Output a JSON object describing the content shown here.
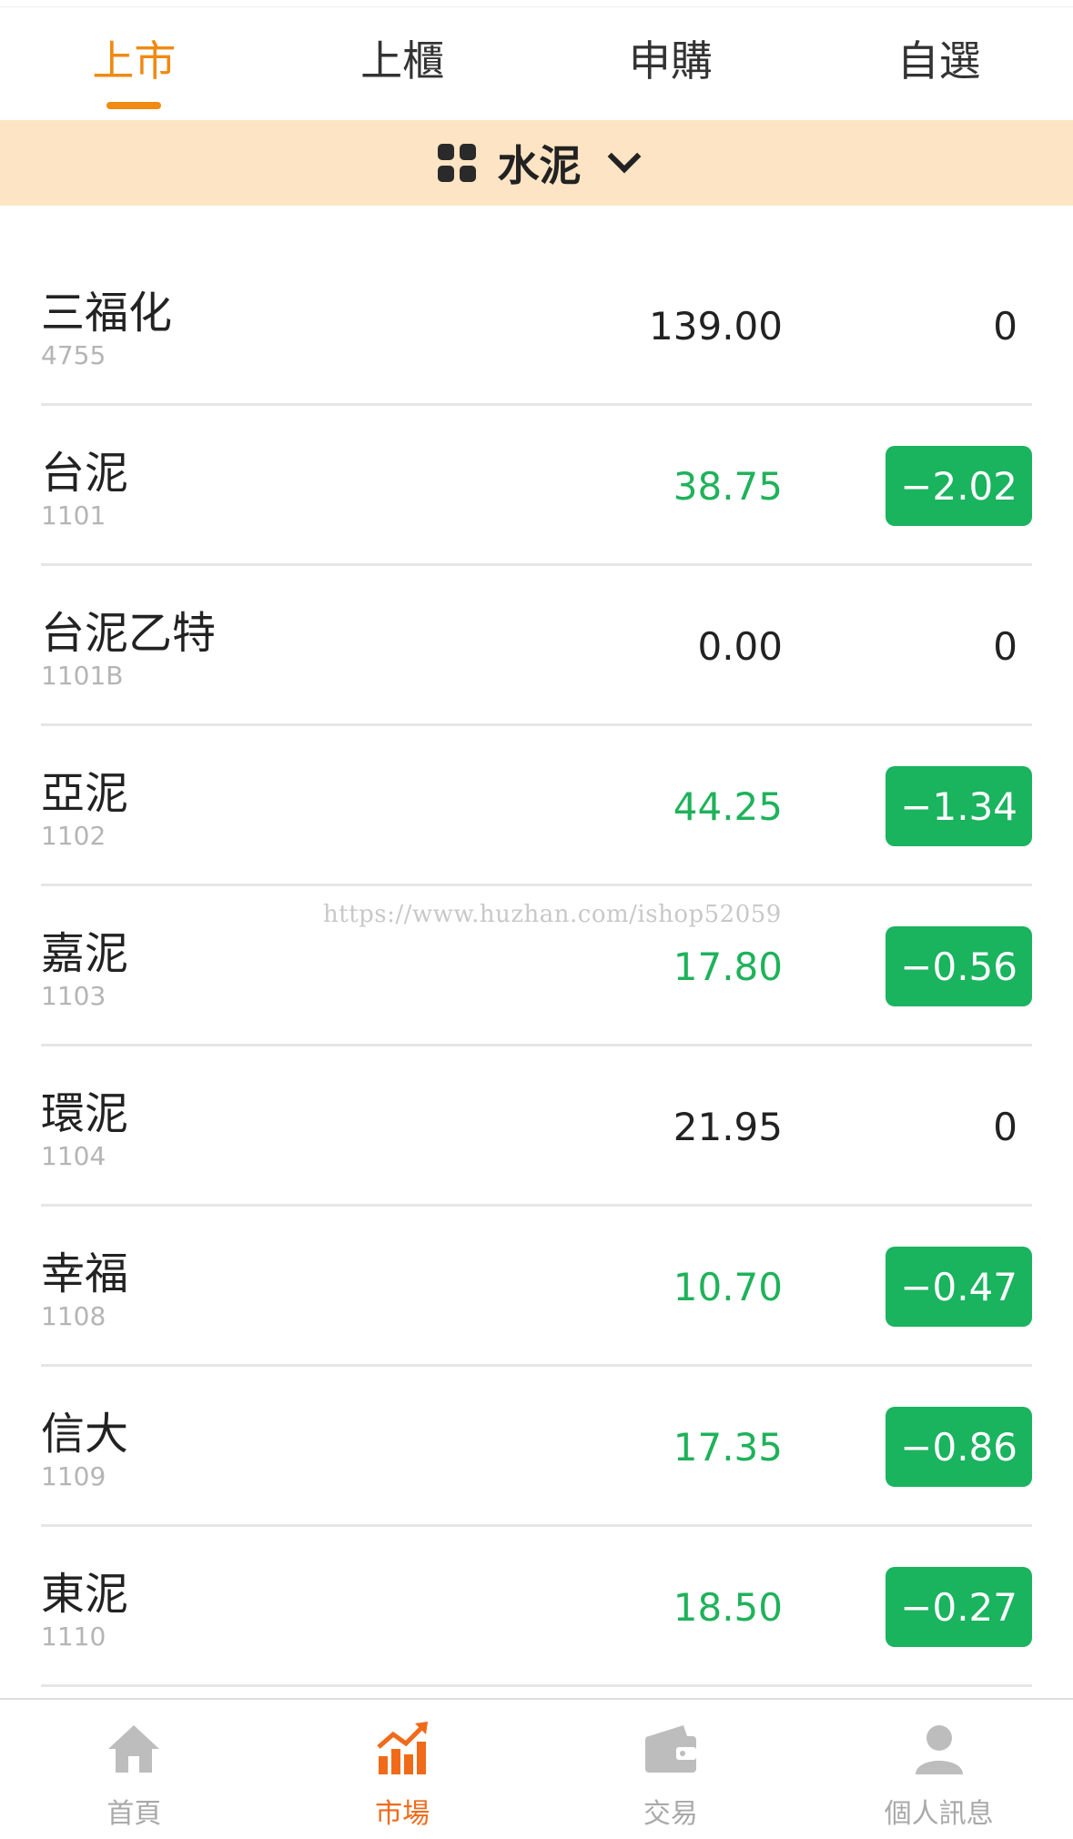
{
  "tabs": [
    {
      "label": "上市",
      "active": true
    },
    {
      "label": "上櫃",
      "active": false
    },
    {
      "label": "申購",
      "active": false
    },
    {
      "label": "自選",
      "active": false
    }
  ],
  "category": {
    "label": "水泥",
    "icon": "grid-icon"
  },
  "stocks": [
    {
      "name": "三福化",
      "code": "4755",
      "price": "139.00",
      "change": "0",
      "trend": "flat"
    },
    {
      "name": "台泥",
      "code": "1101",
      "price": "38.75",
      "change": "−2.02",
      "trend": "down"
    },
    {
      "name": "台泥乙特",
      "code": "1101B",
      "price": "0.00",
      "change": "0",
      "trend": "flat"
    },
    {
      "name": "亞泥",
      "code": "1102",
      "price": "44.25",
      "change": "−1.34",
      "trend": "down"
    },
    {
      "name": "嘉泥",
      "code": "1103",
      "price": "17.80",
      "change": "−0.56",
      "trend": "down"
    },
    {
      "name": "環泥",
      "code": "1104",
      "price": "21.95",
      "change": "0",
      "trend": "flat"
    },
    {
      "name": "幸福",
      "code": "1108",
      "price": "10.70",
      "change": "−0.47",
      "trend": "down"
    },
    {
      "name": "信大",
      "code": "1109",
      "price": "17.35",
      "change": "−0.86",
      "trend": "down"
    },
    {
      "name": "東泥",
      "code": "1110",
      "price": "18.50",
      "change": "−0.27",
      "trend": "down"
    }
  ],
  "watermark": "https://www.huzhan.com/ishop52059",
  "bottom_nav": [
    {
      "label": "首頁",
      "icon": "home-icon",
      "active": false
    },
    {
      "label": "市場",
      "icon": "market-chart-icon",
      "active": true
    },
    {
      "label": "交易",
      "icon": "wallet-icon",
      "active": false
    },
    {
      "label": "個人訊息",
      "icon": "user-icon",
      "active": false
    }
  ],
  "colors": {
    "accent": "#f08a12",
    "down": "#1ab35e",
    "banner": "#fde4c4",
    "nav_active": "#f06a1a",
    "nav_inactive": "#bdbdbd"
  }
}
